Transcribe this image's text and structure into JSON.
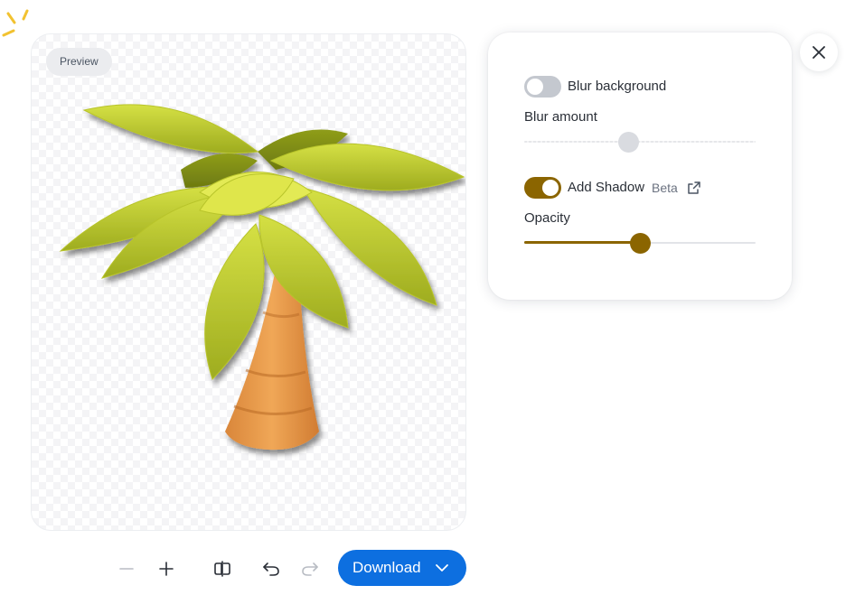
{
  "preview": {
    "badge": "Preview"
  },
  "panel": {
    "blur_background": {
      "label": "Blur background",
      "enabled": false
    },
    "blur_amount": {
      "label": "Blur amount",
      "value": 0.45,
      "disabled": true
    },
    "add_shadow": {
      "label": "Add Shadow",
      "badge": "Beta",
      "enabled": true
    },
    "opacity": {
      "label": "Opacity",
      "value": 0.5
    }
  },
  "toolbar": {
    "download_label": "Download"
  },
  "colors": {
    "accent": "#8b6500",
    "primary_button": "#0d6fe0",
    "toggle_off": "#c4c8cf"
  },
  "icons": [
    "sparkle-icon",
    "close-icon",
    "zoom-out-icon",
    "zoom-in-icon",
    "compare-icon",
    "undo-icon",
    "redo-icon",
    "chevron-down-icon",
    "external-link-icon"
  ]
}
